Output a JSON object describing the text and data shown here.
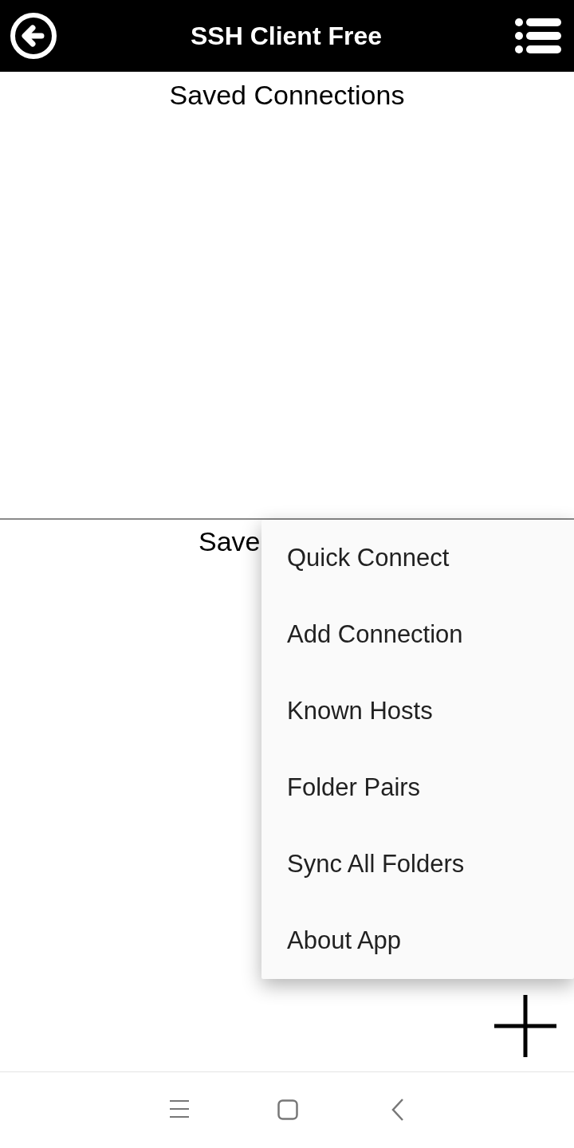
{
  "app_bar": {
    "title": "SSH Client Free"
  },
  "sections": [
    {
      "title": "Saved Connections"
    },
    {
      "title": "Save"
    }
  ],
  "menu": {
    "items": [
      {
        "label": "Quick Connect"
      },
      {
        "label": "Add Connection"
      },
      {
        "label": "Known Hosts"
      },
      {
        "label": "Folder Pairs"
      },
      {
        "label": "Sync All Folders"
      },
      {
        "label": "About App"
      }
    ]
  }
}
